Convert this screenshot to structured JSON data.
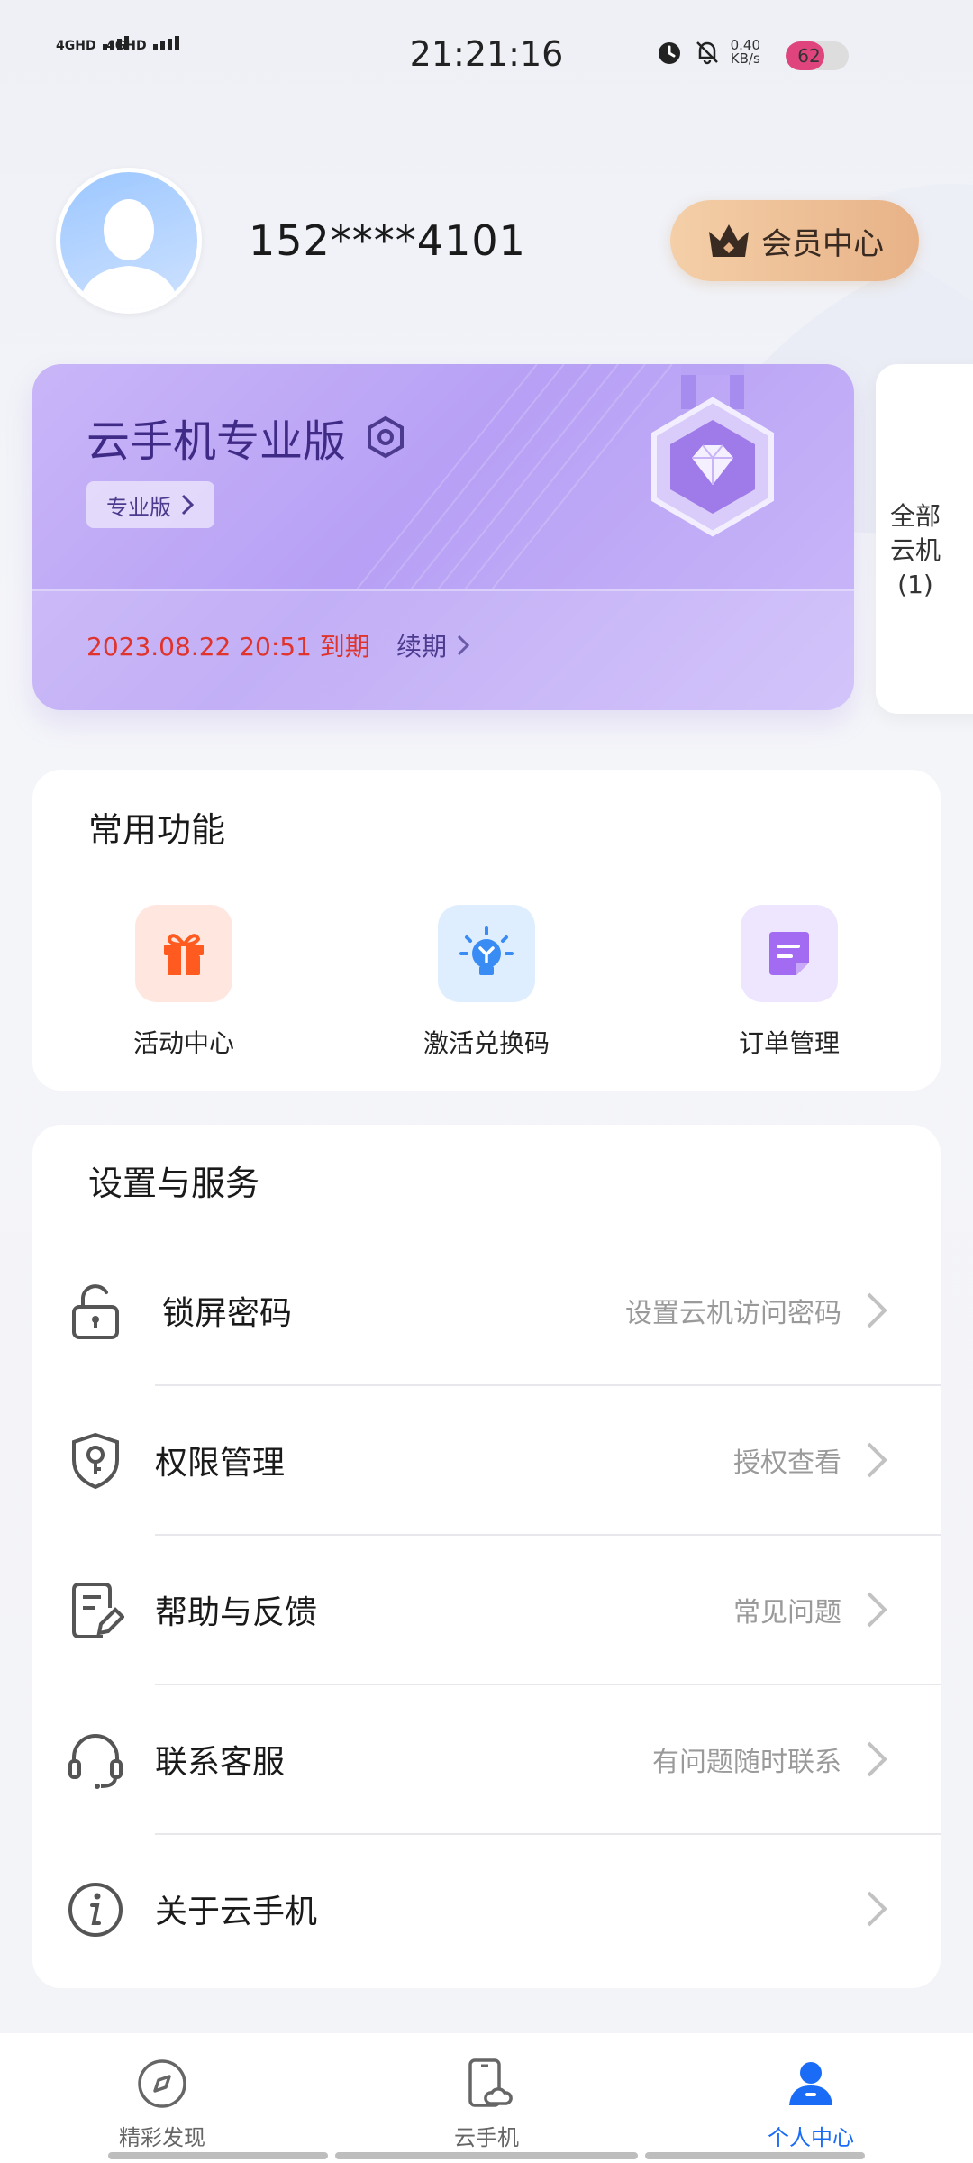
{
  "status_bar": {
    "signal_1": "4GHD",
    "signal_2": "4GHD",
    "time": "21:21:16",
    "speed_value": "0.40",
    "speed_unit": "KB/s",
    "battery_level": "62"
  },
  "profile": {
    "phone": "152****4101",
    "vip_label": "会员中心"
  },
  "member_card": {
    "title": "云手机专业版",
    "edition": "专业版",
    "expire": "2023.08.22 20:51 到期",
    "renew": "续期"
  },
  "side_card": {
    "label_line1": "全部",
    "label_line2": "云机",
    "count": "(1)"
  },
  "common_functions": {
    "title": "常用功能",
    "items": [
      {
        "label": "活动中心",
        "icon": "gift-icon",
        "color": "#ff5a1f"
      },
      {
        "label": "激活兑换码",
        "icon": "lightbulb-icon",
        "color": "#3a8cf5"
      },
      {
        "label": "订单管理",
        "icon": "order-note-icon",
        "color": "#a26bf2"
      }
    ]
  },
  "settings": {
    "title": "设置与服务",
    "items": [
      {
        "label": "锁屏密码",
        "hint": "设置云机访问密码",
        "icon": "lock-icon"
      },
      {
        "label": "权限管理",
        "hint": "授权查看",
        "icon": "shield-key-icon"
      },
      {
        "label": "帮助与反馈",
        "hint": "常见问题",
        "icon": "document-edit-icon"
      },
      {
        "label": "联系客服",
        "hint": "有问题随时联系",
        "icon": "headset-icon"
      },
      {
        "label": "关于云手机",
        "hint": "",
        "icon": "info-icon"
      }
    ]
  },
  "bottom_nav": {
    "items": [
      {
        "label": "精彩发现",
        "icon": "compass-icon"
      },
      {
        "label": "云手机",
        "icon": "cloud-phone-icon"
      },
      {
        "label": "个人中心",
        "icon": "person-icon"
      }
    ],
    "active_index": 2,
    "active_color": "#1a6cf6"
  }
}
